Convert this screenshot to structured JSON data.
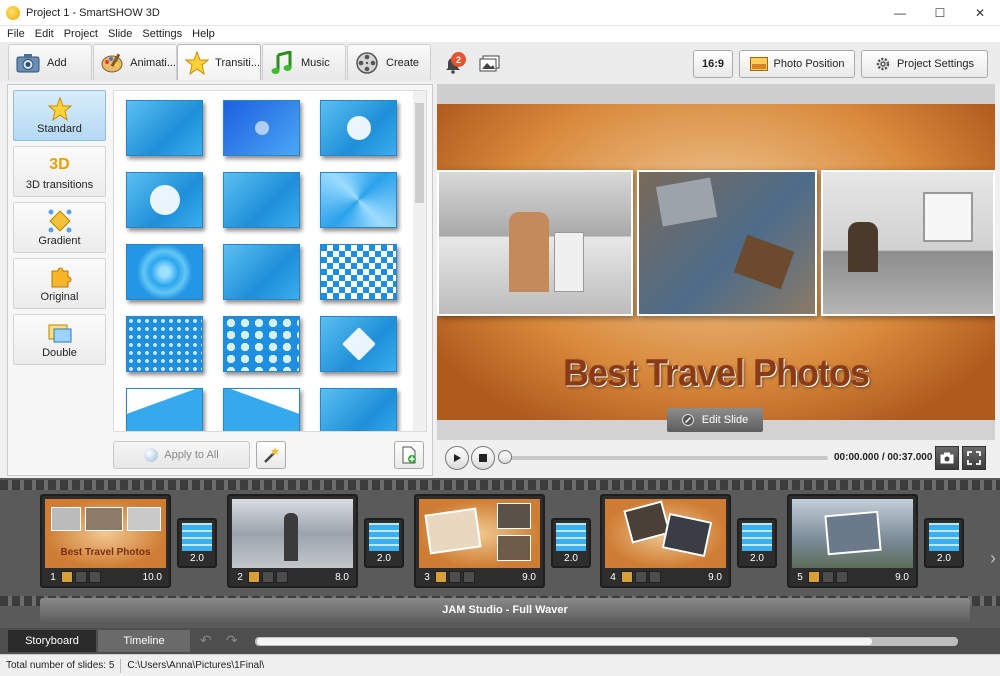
{
  "window": {
    "title": "Project 1 - SmartSHOW 3D",
    "minimize": "—",
    "maximize": "☐",
    "close": "✕"
  },
  "menu": [
    "File",
    "Edit",
    "Project",
    "Slide",
    "Settings",
    "Help"
  ],
  "tabs": [
    {
      "label": "Add",
      "icon": "camera-icon"
    },
    {
      "label": "Animati...",
      "icon": "palette-icon"
    },
    {
      "label": "Transiti...",
      "icon": "star-icon"
    },
    {
      "label": "Music",
      "icon": "music-note-icon"
    },
    {
      "label": "Create",
      "icon": "film-reel-icon"
    }
  ],
  "toolbar_right": {
    "notifications_count": "2",
    "aspect_ratio": "16:9",
    "photo_position": "Photo Position",
    "project_settings": "Project Settings"
  },
  "categories": [
    {
      "label": "Standard",
      "icon": "star-icon",
      "active": true
    },
    {
      "label": "3D transitions",
      "icon": "3d-icon",
      "badge": "3D",
      "active": false
    },
    {
      "label": "Gradient",
      "icon": "gradient-icon",
      "active": false
    },
    {
      "label": "Original",
      "icon": "puzzle-icon",
      "active": false
    },
    {
      "label": "Double",
      "icon": "double-icon",
      "active": false
    }
  ],
  "apply_all_label": "Apply to All",
  "preview": {
    "slide_title": "Best Travel Photos",
    "edit_slide": "Edit Slide"
  },
  "player": {
    "time": "00:00.000 / 00:37.000"
  },
  "slides": [
    {
      "num": "1",
      "duration": "10.0",
      "transition": "2.0"
    },
    {
      "num": "2",
      "duration": "8.0",
      "transition": "2.0"
    },
    {
      "num": "3",
      "duration": "9.0",
      "transition": "2.0"
    },
    {
      "num": "4",
      "duration": "9.0",
      "transition": "2.0"
    },
    {
      "num": "5",
      "duration": "9.0",
      "transition": "2.0"
    }
  ],
  "slide1_caption": "Best Travel Photos",
  "music_track": "JAM Studio - Full Waver",
  "bottom_tabs": {
    "storyboard": "Storyboard",
    "timeline": "Timeline"
  },
  "status": {
    "total_slides": "Total number of slides: 5",
    "path": "C:\\Users\\Anna\\Pictures\\1Final\\"
  }
}
